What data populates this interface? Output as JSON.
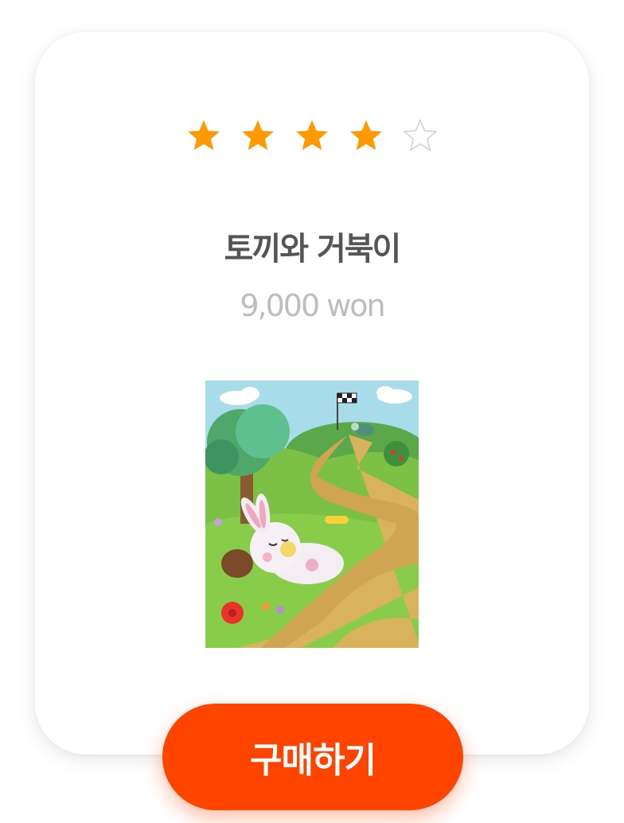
{
  "product": {
    "rating": {
      "value": 4,
      "max": 5
    },
    "title": "토끼와 거북이",
    "price": "9,000 won"
  },
  "actions": {
    "buy_label": "구매하기"
  },
  "colors": {
    "star_filled": "#ff9900",
    "star_empty": "#cfcfcf",
    "button": "#ff4400",
    "title": "#555555",
    "price": "#bdbdbd"
  }
}
